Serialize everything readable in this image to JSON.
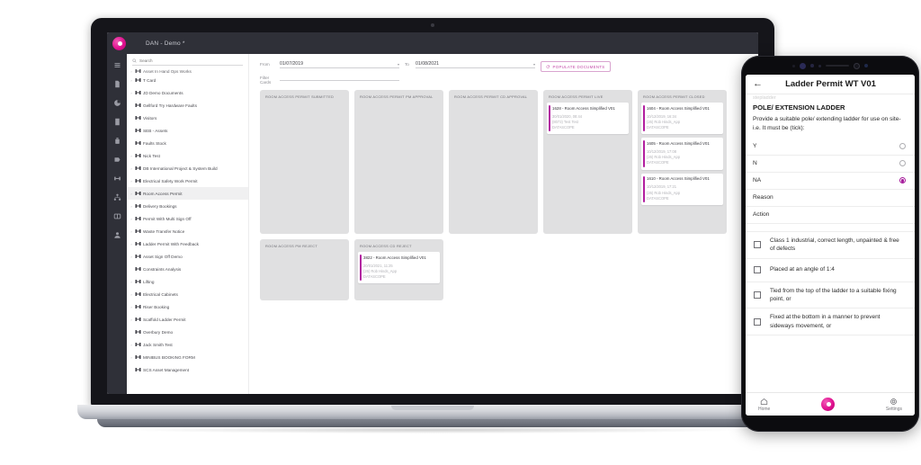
{
  "laptop": {
    "topbar": {
      "title": "DAN - Demo *",
      "logo_icon": "datascope-logo-icon",
      "building_icon": "building-icon"
    },
    "rail": [
      {
        "name": "menu-icon"
      },
      {
        "name": "document-icon"
      },
      {
        "name": "pie-chart-icon"
      },
      {
        "name": "file-icon"
      },
      {
        "name": "bin-icon"
      },
      {
        "name": "tag-icon"
      },
      {
        "name": "link-icon"
      },
      {
        "name": "hierarchy-icon"
      },
      {
        "name": "board-icon"
      },
      {
        "name": "user-icon"
      }
    ],
    "tree": {
      "search_placeholder": "Search",
      "selected": "Room Access Permit",
      "items": [
        {
          "label": "Asset In Hand Ops Works",
          "expandable": true,
          "clipped": true
        },
        {
          "label": "T Card",
          "expandable": true
        },
        {
          "label": "JD Demo Documents",
          "expandable": true
        },
        {
          "label": "Gellford Try Hardware Faults",
          "expandable": false
        },
        {
          "label": "Visitors",
          "expandable": false
        },
        {
          "label": "SEB - Assets",
          "expandable": false
        },
        {
          "label": "Faults Stock",
          "expandable": false
        },
        {
          "label": "Nick Test",
          "expandable": true
        },
        {
          "label": "DB International Project & System Build",
          "expandable": true
        },
        {
          "label": "Electrical Safety Work Permit",
          "expandable": true
        },
        {
          "label": "Room Access Permit",
          "expandable": true
        },
        {
          "label": "Delivery Bookings",
          "expandable": true
        },
        {
          "label": "Permit With Multi Sign Off",
          "expandable": true
        },
        {
          "label": "Waste Transfer Notice",
          "expandable": true
        },
        {
          "label": "Ladder Permit With Feedback",
          "expandable": true
        },
        {
          "label": "Asset Sign Off Demo",
          "expandable": true
        },
        {
          "label": "Constraints Analysis",
          "expandable": false
        },
        {
          "label": "Lifting",
          "expandable": true
        },
        {
          "label": "Electrical Cabinets",
          "expandable": true
        },
        {
          "label": "Riser Booking",
          "expandable": true
        },
        {
          "label": "Scaffold Ladder Permit",
          "expandable": true
        },
        {
          "label": "Overbury Demo",
          "expandable": false
        },
        {
          "label": "Jack Smith Test",
          "expandable": true
        },
        {
          "label": "MINIBUS BOOKING FORM",
          "expandable": true
        },
        {
          "label": "SCS Asset Management",
          "expandable": false
        }
      ]
    },
    "filters": {
      "from_label": "From",
      "from_value": "01/07/2019",
      "to_label": "To",
      "to_value": "01/08/2021",
      "filter_cards_label": "Filter Cards",
      "filter_cards_value": "",
      "populate_button": "POPULATE DOCUMENTS",
      "populate_icon": "refresh-icon"
    },
    "board": {
      "columns": [
        {
          "title": "ROOM ACCESS PERMIT SUBMITTED",
          "size": "tall",
          "cards": []
        },
        {
          "title": "ROOM ACCESS PERMIT PM APPROVAL",
          "size": "tall",
          "cards": []
        },
        {
          "title": "ROOM ACCESS PERMIT CD APPROVAL",
          "size": "tall",
          "cards": []
        },
        {
          "title": "ROOM ACCESS PERMIT LIVE",
          "size": "tall",
          "cards": [
            {
              "title": "1628 - Room Access Simplified V01",
              "date": "30/01/2020, 08:44",
              "user": "(8073) Test Test",
              "org": "DATASCOPE"
            }
          ]
        },
        {
          "title": "ROOM ACCESS PERMIT CLOSED",
          "size": "tall",
          "cards": [
            {
              "title": "1604 - Room Access Simplified V01",
              "date": "10/12/2019, 16:34",
              "user": "(26) Rob Hinds_App",
              "org": "DATASCOPE"
            },
            {
              "title": "1605 - Room Access Simplified V01",
              "date": "10/12/2019, 17:08",
              "user": "(26) Rob Hinds_App",
              "org": "DATASCOPE"
            },
            {
              "title": "1610 - Room Access Simplified V01",
              "date": "10/12/2019, 17:21",
              "user": "(26) Rob Hinds_App",
              "org": "DATASCOPE"
            }
          ]
        },
        {
          "title": "ROOM ACCESS PM REJECT",
          "size": "short",
          "cards": []
        },
        {
          "title": "ROOM ACCESS CD REJECT",
          "size": "short",
          "cards": [
            {
              "title": "3822 - Room Access Simplified V01",
              "date": "20/01/2021, 11:25",
              "user": "(26) Rob Hinds_App",
              "org": "DATASCOPE"
            }
          ]
        }
      ]
    }
  },
  "phone": {
    "header": {
      "back_icon": "back-arrow-icon",
      "title": "Ladder Permit WT V01"
    },
    "clipped_text": "stepladder",
    "section_title": "POLE/ EXTENSION LADDER",
    "question": "Provide a suitable pole/ extending ladder for use on site- i.e. It must be (tick):",
    "options": [
      {
        "label": "Y",
        "selected": false
      },
      {
        "label": "N",
        "selected": false
      },
      {
        "label": "NA",
        "selected": true
      }
    ],
    "fields": [
      {
        "label": "Reason"
      },
      {
        "label": "Action"
      }
    ],
    "checkboxes": [
      {
        "label": "Class 1 industrial, correct length, unpainted & free of defects",
        "checked": false
      },
      {
        "label": "Placed at an angle of 1:4",
        "checked": false
      },
      {
        "label": "Tied from the top of the ladder to a suitable fixing point, or",
        "checked": false
      },
      {
        "label": "Fixed at the bottom in a manner to prevent sideways movement, or",
        "checked": false
      }
    ],
    "nav": [
      {
        "label": "Home",
        "icon": "home-icon"
      },
      {
        "label": "",
        "icon": "datascope-logo-icon"
      },
      {
        "label": "Settings",
        "icon": "gear-icon"
      }
    ]
  },
  "colors": {
    "accent": "#b21fa0",
    "brand_pink": "#e0118f",
    "dark": "#2f3038",
    "column_bg": "#e0e0e1"
  }
}
